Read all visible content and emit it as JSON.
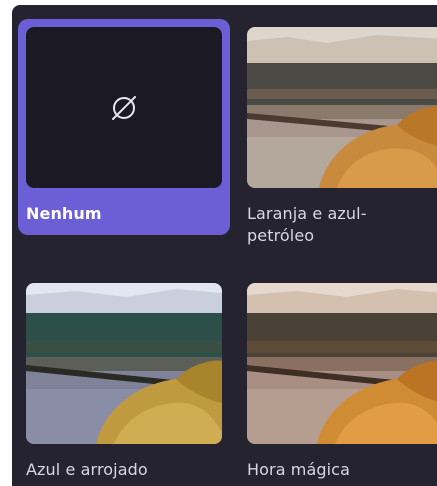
{
  "filters": [
    {
      "id": "none",
      "label": "Nenhum",
      "selected": true,
      "icon": "no-filter-icon"
    },
    {
      "id": "orange-teal",
      "label": "Laranja e azul-\npetróleo",
      "selected": false
    },
    {
      "id": "blue-bold",
      "label": "Azul e arrojado",
      "selected": false
    },
    {
      "id": "golden-hour",
      "label": "Hora mágica",
      "selected": false
    }
  ],
  "colors": {
    "panel_background": "#24232f",
    "selected_accent": "#6c5fd6",
    "none_thumb_background": "#1b1a24",
    "label_text": "#d9d7e2"
  }
}
